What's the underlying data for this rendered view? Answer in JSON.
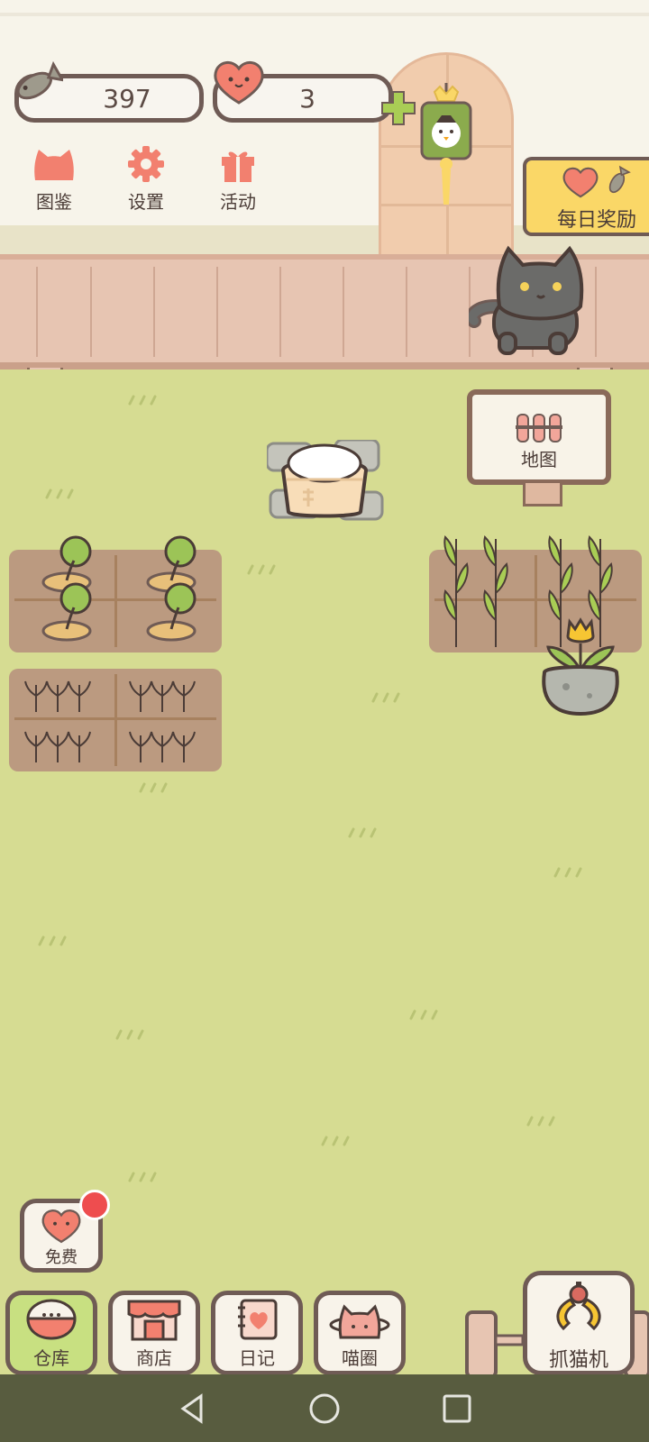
{
  "currency": {
    "fish_count": "397",
    "heart_count": "3"
  },
  "top_menu": [
    {
      "label": "图鉴",
      "icon": "cat-head-icon"
    },
    {
      "label": "设置",
      "icon": "gear-icon"
    },
    {
      "label": "活动",
      "icon": "gift-icon"
    }
  ],
  "daily_reward": {
    "label": "每日奖励"
  },
  "map_sign": {
    "label": "地图"
  },
  "free_button": {
    "label": "免费"
  },
  "bottom_tabs": [
    {
      "label": "仓库",
      "icon": "rice-bowl-icon",
      "active": true
    },
    {
      "label": "商店",
      "icon": "shop-icon",
      "active": false
    },
    {
      "label": "日记",
      "icon": "diary-icon",
      "active": false
    },
    {
      "label": "喵圈",
      "icon": "cat-planet-icon",
      "active": false
    }
  ],
  "claw_machine": {
    "label": "抓猫机"
  },
  "colors": {
    "grass": "#d6dc92",
    "outline": "#6f5b55",
    "accent_yellow": "#fad767",
    "accent_pink": "#f2806f",
    "badge_red": "#ee4d4f",
    "active_tab": "#c8e081",
    "nav_bar": "#585c3f"
  }
}
